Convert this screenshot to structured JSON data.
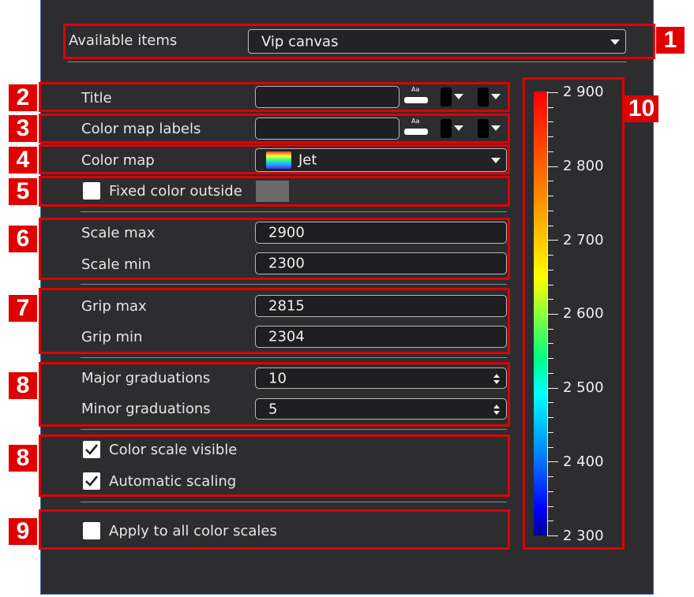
{
  "available_items": {
    "label": "Available items",
    "value": "Vip canvas"
  },
  "title_row": {
    "label": "Title",
    "value": ""
  },
  "color_map_labels_row": {
    "label": "Color map labels",
    "value": ""
  },
  "color_map_row": {
    "label": "Color map",
    "value": "Jet"
  },
  "fixed_color_outside": {
    "label": "Fixed color outside",
    "checked": false,
    "swatch_color": "#6b6b6b"
  },
  "scale": {
    "max_label": "Scale max",
    "max_value": "2900",
    "min_label": "Scale min",
    "min_value": "2300"
  },
  "grip": {
    "max_label": "Grip max",
    "max_value": "2815",
    "min_label": "Grip min",
    "min_value": "2304"
  },
  "graduations": {
    "major_label": "Major graduations",
    "major_value": "10",
    "minor_label": "Minor graduations",
    "minor_value": "5"
  },
  "options": {
    "color_scale_visible": {
      "label": "Color scale visible",
      "checked": true
    },
    "automatic_scaling": {
      "label": "Automatic scaling",
      "checked": true
    },
    "apply_all": {
      "label": "Apply to all color scales",
      "checked": false
    }
  },
  "colorbar": {
    "colormap": "jet",
    "min": 2300,
    "max": 2900,
    "tick_labels": [
      "2 900",
      "2 800",
      "2 700",
      "2 600",
      "2 500",
      "2 400",
      "2 300"
    ]
  },
  "badges": {
    "b1": "1",
    "b2": "2",
    "b3": "3",
    "b4": "4",
    "b5": "5",
    "b6": "6",
    "b7": "7",
    "b8a": "8",
    "b8b": "8",
    "b9": "9",
    "b10": "10"
  },
  "colors": {
    "annotation_red": "#e00000",
    "panel_bg": "#2d2d30"
  }
}
